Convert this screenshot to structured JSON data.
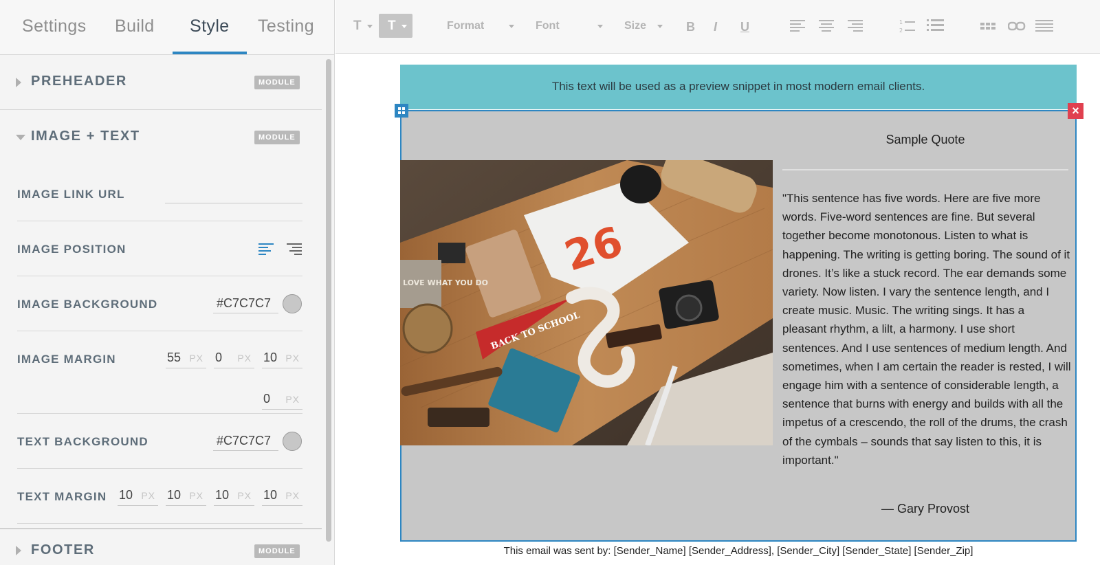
{
  "tabs": [
    {
      "label": "Settings"
    },
    {
      "label": "Build"
    },
    {
      "label": "Style",
      "active": true
    },
    {
      "label": "Testing"
    }
  ],
  "sections": {
    "preheader": {
      "title": "PREHEADER",
      "badge": "MODULE",
      "expanded": false
    },
    "image_text": {
      "title": "IMAGE + TEXT",
      "badge": "MODULE",
      "expanded": true
    },
    "footer": {
      "title": "FOOTER",
      "badge": "MODULE",
      "expanded": false
    }
  },
  "fields": {
    "image_link_url": {
      "label": "IMAGE LINK URL",
      "value": ""
    },
    "image_position": {
      "label": "IMAGE POSITION",
      "options": [
        "align-left-icon",
        "align-right-icon"
      ],
      "selected": "left"
    },
    "image_background": {
      "label": "IMAGE BACKGROUND",
      "value": "#C7C7C7",
      "swatch": "#c7c7c7"
    },
    "image_margin": {
      "label": "IMAGE MARGIN",
      "values": [
        "55",
        "0",
        "10",
        "0"
      ],
      "unit": "PX"
    },
    "text_background": {
      "label": "TEXT BACKGROUND",
      "value": "#C7C7C7",
      "swatch": "#c7c7c7"
    },
    "text_margin": {
      "label": "TEXT MARGIN",
      "values": [
        "10",
        "10",
        "10",
        "10"
      ],
      "unit": "PX"
    }
  },
  "toolbar": {
    "text_style_1": "T",
    "text_style_2": "T",
    "format": "Format",
    "font": "Font",
    "size": "Size",
    "bold": "B",
    "italic": "I",
    "underline": "U"
  },
  "email": {
    "preheader_text": "This text will be used as a preview snippet in most modern email clients.",
    "quote_title": "Sample Quote",
    "quote_text": "\"This sentence has five words. Here are five more words. Five-word sentences are fine. But several together become monotonous. Listen to what is happening. The writing is getting boring. The sound of it drones. It’s like a stuck record. The ear demands some variety. Now listen. I vary the sentence length, and I create music. Music. The writing sings. It has a pleasant rhythm, a lilt, a harmony. I use short sentences. And I use sentences of medium length. And sometimes, when I am certain the reader is rested, I will engage him with a sentence of considerable length, a sentence that burns with energy and builds with all the impetus of a crescendo, the roll of the drums, the crash of the cymbals – sounds that say listen to this, it is important.\"",
    "quote_author": "— Gary Provost",
    "footer_line": "This email was sent by: [Sender_Name] [Sender_Address], [Sender_City] [Sender_State] [Sender_Zip]",
    "module_bg": "#C7C7C7",
    "preheader_bg": "#6cc3cc",
    "photo_signs": [
      "BACK TO SCHOOL",
      "LOVE WHAT YOU DO",
      "26"
    ]
  },
  "colors": {
    "accent": "#2d86c2",
    "close": "#e0404f"
  }
}
